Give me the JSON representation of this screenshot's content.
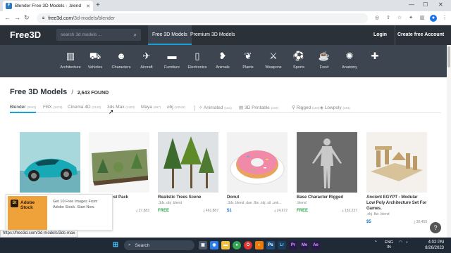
{
  "browser": {
    "tab_title": "Blender Free 3D Models - .blend",
    "url_host": "free3d.com",
    "url_path": "/3d-models/blender",
    "status_url": "https://free3d.com/3d-models/3ds-max"
  },
  "site": {
    "logo": "Free3D",
    "search_placeholder": "search 3d models ...",
    "nav": [
      "Free 3D Models",
      "Premium 3D Models"
    ],
    "login": "Login",
    "create_account": "Create free Account"
  },
  "categories": [
    {
      "label": "Architecture",
      "icon": "building-icon"
    },
    {
      "label": "Vehicles",
      "icon": "car-icon"
    },
    {
      "label": "Characters",
      "icon": "people-icon"
    },
    {
      "label": "Aircraft",
      "icon": "plane-icon"
    },
    {
      "label": "Furniture",
      "icon": "sofa-icon"
    },
    {
      "label": "Electronics",
      "icon": "phone-icon"
    },
    {
      "label": "Animals",
      "icon": "bird-icon"
    },
    {
      "label": "Plants",
      "icon": "leaf-icon"
    },
    {
      "label": "Weapons",
      "icon": "weapon-icon"
    },
    {
      "label": "Sports",
      "icon": "ball-icon"
    },
    {
      "label": "Food",
      "icon": "food-icon"
    },
    {
      "label": "Anatomy",
      "icon": "anatomy-icon"
    },
    {
      "label": "",
      "icon": "plus-icon"
    }
  ],
  "heading": {
    "title": "Free 3D Models",
    "separator": "/",
    "count": "2,643 FOUND"
  },
  "filters": [
    {
      "label": "Blender",
      "count": "(2643)"
    },
    {
      "label": "FBX",
      "count": "(3476)"
    },
    {
      "label": "Cinema 4D",
      "count": "(2120)"
    },
    {
      "label": "3ds Max",
      "count": "(1403)"
    },
    {
      "label": "Maya",
      "count": "(667)"
    },
    {
      "label": "obj",
      "count": "(10942)"
    },
    {
      "label": "Animated",
      "count": "(161)"
    },
    {
      "label": "3D Printable",
      "count": "(223)"
    },
    {
      "label": "Rigged",
      "count": "(183)"
    },
    {
      "label": "Lowpoly",
      "count": "(491)"
    }
  ],
  "cards": [
    {
      "name": "",
      "formats": "",
      "price": "",
      "downloads": ""
    },
    {
      "name": "Forest Pack",
      "formats": "",
      "price": "",
      "downloads": "27,883"
    },
    {
      "name": "Realistic Trees Scene",
      "formats": ".3ds .obj .blend",
      "price": "FREE",
      "downloads": "461,887"
    },
    {
      "name": "Donut",
      "formats": ".3ds .blend .dae .fbx .obj .stl .unk...",
      "price": "$1",
      "downloads": "24,672"
    },
    {
      "name": "Base Character Rigged",
      "formats": ".blend",
      "price": "FREE",
      "downloads": "182,237"
    },
    {
      "name": "Ancient EGYPT - Modular Low Poly Architecture Set For Games.",
      "formats": ".obj .fbx .blend",
      "price": "$5",
      "downloads": "30,459"
    }
  ],
  "ad": {
    "badge": "St",
    "title": "Adobe Stock",
    "text": "Get 10 Free Images From Adobe Stock. Start Now."
  },
  "taskbar": {
    "search_label": "Search",
    "lang": "ENG",
    "region": "IN",
    "time": "4:02 PM",
    "date": "8/26/2023"
  },
  "colors": {
    "header_bg": "#2b3139",
    "catbar_bg": "#3d4650",
    "accent": "#1aa0d8",
    "free_price": "#2aa44a",
    "paid_price": "#1a73c8"
  }
}
